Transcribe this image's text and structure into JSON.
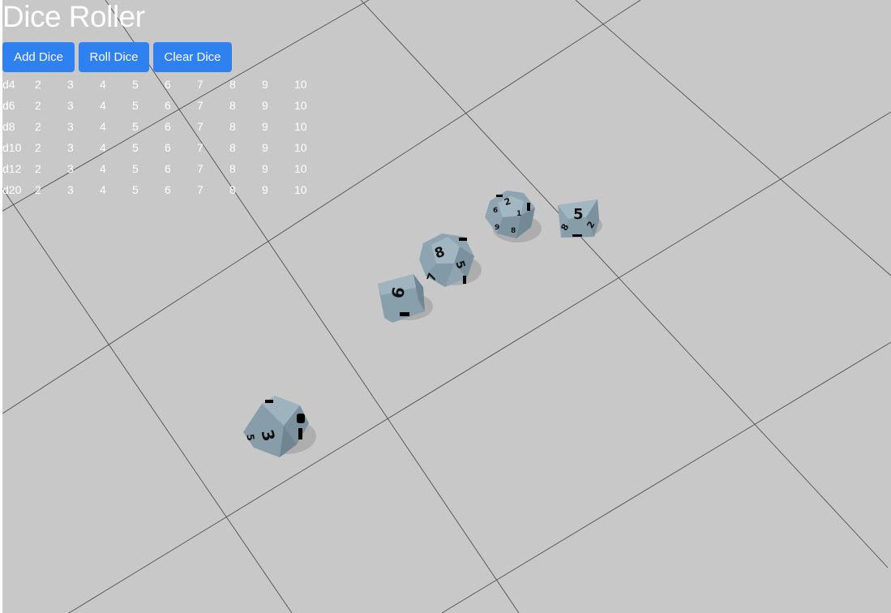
{
  "header": {
    "title": "Dice Roller"
  },
  "toolbar": {
    "add_label": "Add Dice",
    "roll_label": "Roll Dice",
    "clear_label": "Clear Dice"
  },
  "dice_table": {
    "rows": [
      {
        "type": "d4",
        "counts": [
          "2",
          "3",
          "4",
          "5",
          "6",
          "7",
          "8",
          "9",
          "10"
        ]
      },
      {
        "type": "d6",
        "counts": [
          "2",
          "3",
          "4",
          "5",
          "6",
          "7",
          "8",
          "9",
          "10"
        ]
      },
      {
        "type": "d8",
        "counts": [
          "2",
          "3",
          "4",
          "5",
          "6",
          "7",
          "8",
          "9",
          "10"
        ]
      },
      {
        "type": "d10",
        "counts": [
          "2",
          "3",
          "4",
          "5",
          "6",
          "7",
          "8",
          "9",
          "10"
        ]
      },
      {
        "type": "d12",
        "counts": [
          "2",
          "3",
          "4",
          "5",
          "6",
          "7",
          "8",
          "9",
          "10"
        ]
      },
      {
        "type": "d20",
        "counts": [
          "2",
          "3",
          "4",
          "5",
          "6",
          "7",
          "8",
          "9",
          "10"
        ]
      }
    ]
  },
  "scene": {
    "dice": [
      {
        "name": "dice-d10",
        "face": "3"
      },
      {
        "name": "dice-d6",
        "face": "9"
      },
      {
        "name": "dice-d12",
        "face": "8"
      },
      {
        "name": "dice-d20",
        "face": "2"
      },
      {
        "name": "dice-d8",
        "face": "5"
      }
    ]
  },
  "colors": {
    "background": "#c8c8c8",
    "button": "#2f80f0",
    "text": "#ffffff",
    "die": "#8fa6b2",
    "grid": "#4a4a4a"
  }
}
